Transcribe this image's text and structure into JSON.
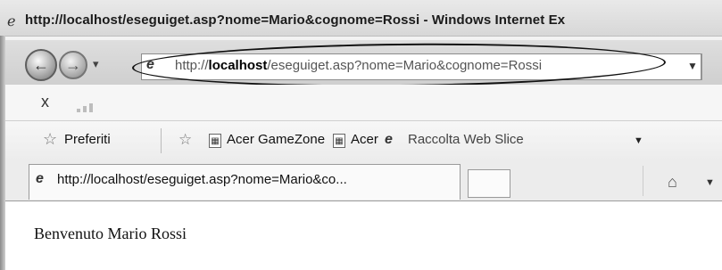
{
  "window": {
    "title": "http://localhost/eseguiget.asp?nome=Mario&cognome=Rossi - Windows Internet Ex",
    "title_icon": "ie-icon"
  },
  "navigation": {
    "back_icon": "back-arrow-icon",
    "forward_icon": "forward-arrow-icon",
    "dropdown_icon": "chevron-down-icon"
  },
  "address_bar": {
    "url_prefix": "http://",
    "url_host": "localhost",
    "url_rest": "/eseguiget.asp?nome=Mario&cognome=Rossi",
    "highlight": "hand-drawn ellipse"
  },
  "command_bar": {
    "close_label": "x"
  },
  "favorites_bar": {
    "favorites_label": "Preferiti",
    "items": [
      {
        "label": "Acer GameZone",
        "icon": "page-icon"
      },
      {
        "label": "Acer",
        "icon": "page-icon"
      },
      {
        "label": "Raccolta Web Slice",
        "icon": "ie-icon"
      }
    ]
  },
  "tabs": [
    {
      "label": "http://localhost/eseguiget.asp?nome=Mario&co...",
      "active": true
    }
  ],
  "toolbar": {
    "home_icon": "home-icon"
  },
  "page": {
    "content_text": "Benvenuto Mario Rossi"
  }
}
